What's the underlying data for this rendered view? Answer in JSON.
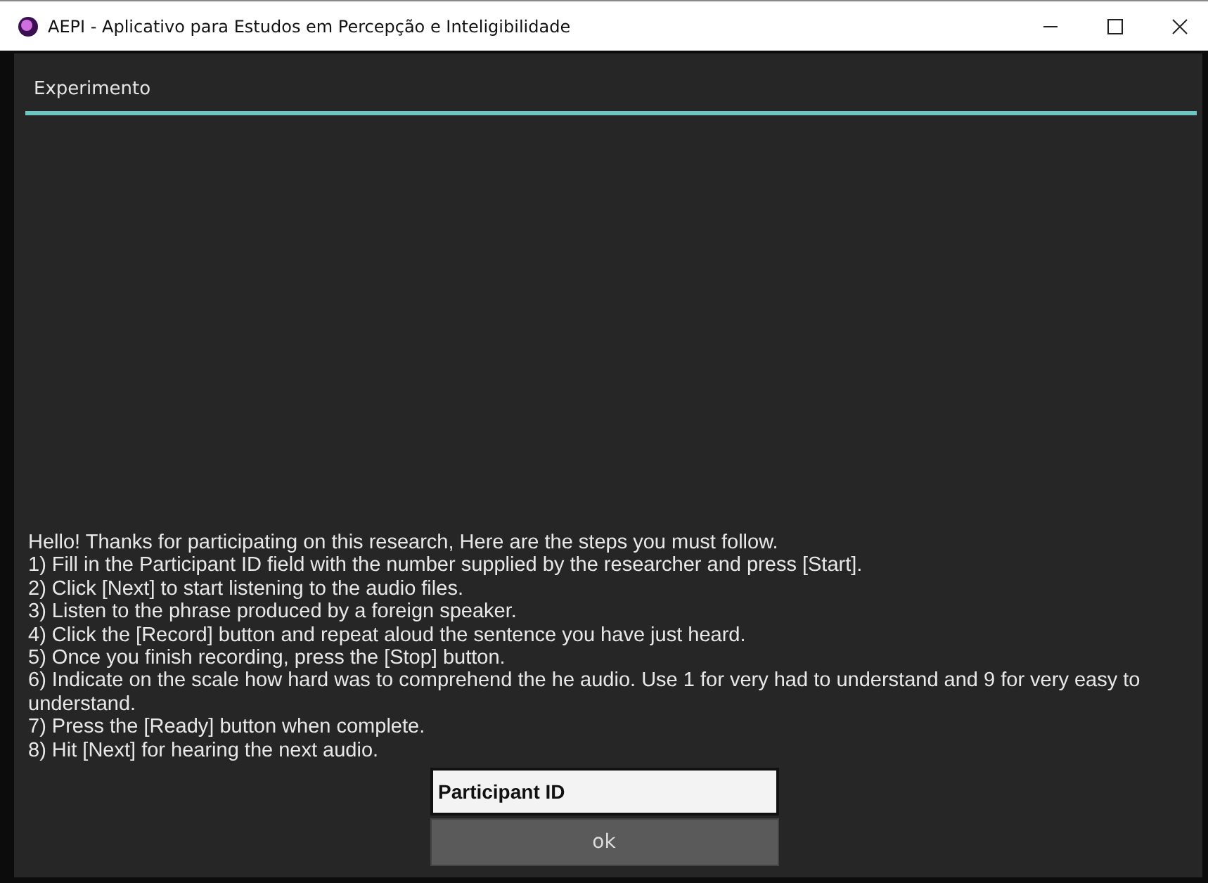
{
  "window": {
    "title": "AEPI - Aplicativo para Estudos em Percepção e Inteligibilidade"
  },
  "tabs": [
    {
      "label": "Experimento",
      "selected": true
    }
  ],
  "instructions": [
    "Hello! Thanks for participating on this research, Here are the steps you must follow.",
    "1) Fill in the Participant ID field with the number supplied by the researcher and press [Start].",
    "2) Click [Next] to start listening to the audio files.",
    "3) Listen to the phrase produced by a foreign speaker.",
    "4) Click the [Record] button and repeat aloud the sentence you have just heard.",
    "5) Once you finish recording, press the [Stop] button.",
    "6) Indicate on the scale how hard was to comprehend the he audio. Use 1 for very had to understand and  9 for very easy to understand.",
    "7) Press the [Ready] button when complete.",
    "8) Hit [Next] for hearing the next audio."
  ],
  "participant_field": {
    "placeholder": "Participant ID"
  },
  "buttons": [
    "ok"
  ]
}
